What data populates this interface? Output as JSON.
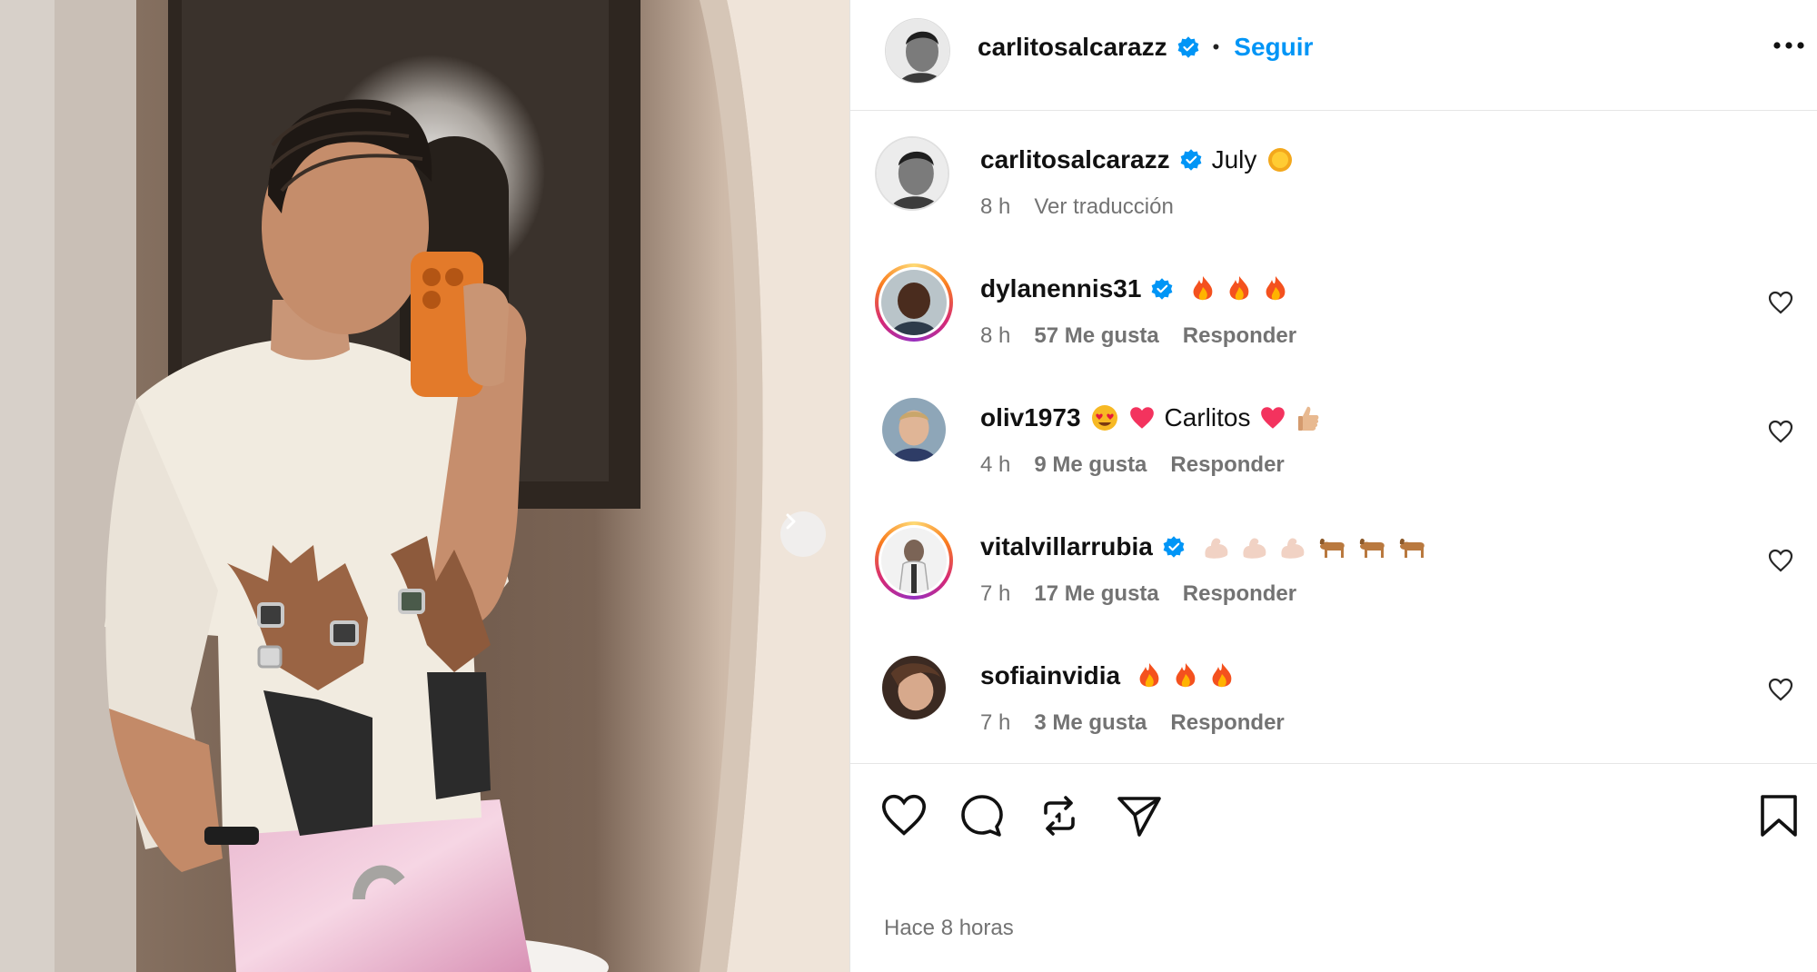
{
  "post": {
    "author": "carlitosalcarazz",
    "follow_label": "Seguir",
    "separator": "•",
    "caption_text": "July",
    "caption_emoji": "sun",
    "caption_time": "8 h",
    "translate_label": "Ver traducción",
    "time_ago": "Hace 8 horas"
  },
  "comments": [
    {
      "user": "dylanennis31",
      "verified": true,
      "text": "",
      "emojis": [
        "fire",
        "fire",
        "fire"
      ],
      "time": "8 h",
      "likes": "57 Me gusta",
      "reply": "Responder",
      "story_ring": true
    },
    {
      "user": "oliv1973",
      "verified": false,
      "text_before": "",
      "text": "Carlitos",
      "emojis_before": [
        "heart-eyes",
        "red-heart"
      ],
      "emojis_after": [
        "red-heart",
        "thumbs-up"
      ],
      "time": "4 h",
      "likes": "9 Me gusta",
      "reply": "Responder",
      "story_ring": false
    },
    {
      "user": "vitalvillarrubia",
      "verified": true,
      "text": "",
      "emojis": [
        "flexed-biceps",
        "flexed-biceps",
        "flexed-biceps",
        "goat",
        "goat",
        "goat"
      ],
      "time": "7 h",
      "likes": "17 Me gusta",
      "reply": "Responder",
      "story_ring": true
    },
    {
      "user": "sofiainvidia",
      "verified": false,
      "text": "",
      "emojis": [
        "fire",
        "fire",
        "fire"
      ],
      "time": "7 h",
      "likes": "3 Me gusta",
      "reply": "Responder",
      "story_ring": false
    }
  ],
  "colors": {
    "accent": "#0095f6",
    "verified": "#0095f6",
    "muted": "#737373",
    "divider": "#e6e6e6"
  },
  "icons": {
    "like": "heart-icon",
    "comment": "comment-bubble-icon",
    "repost": "repost-icon",
    "share": "paper-plane-icon",
    "save": "bookmark-icon",
    "more": "more-options-icon",
    "next": "chevron-right-icon"
  }
}
